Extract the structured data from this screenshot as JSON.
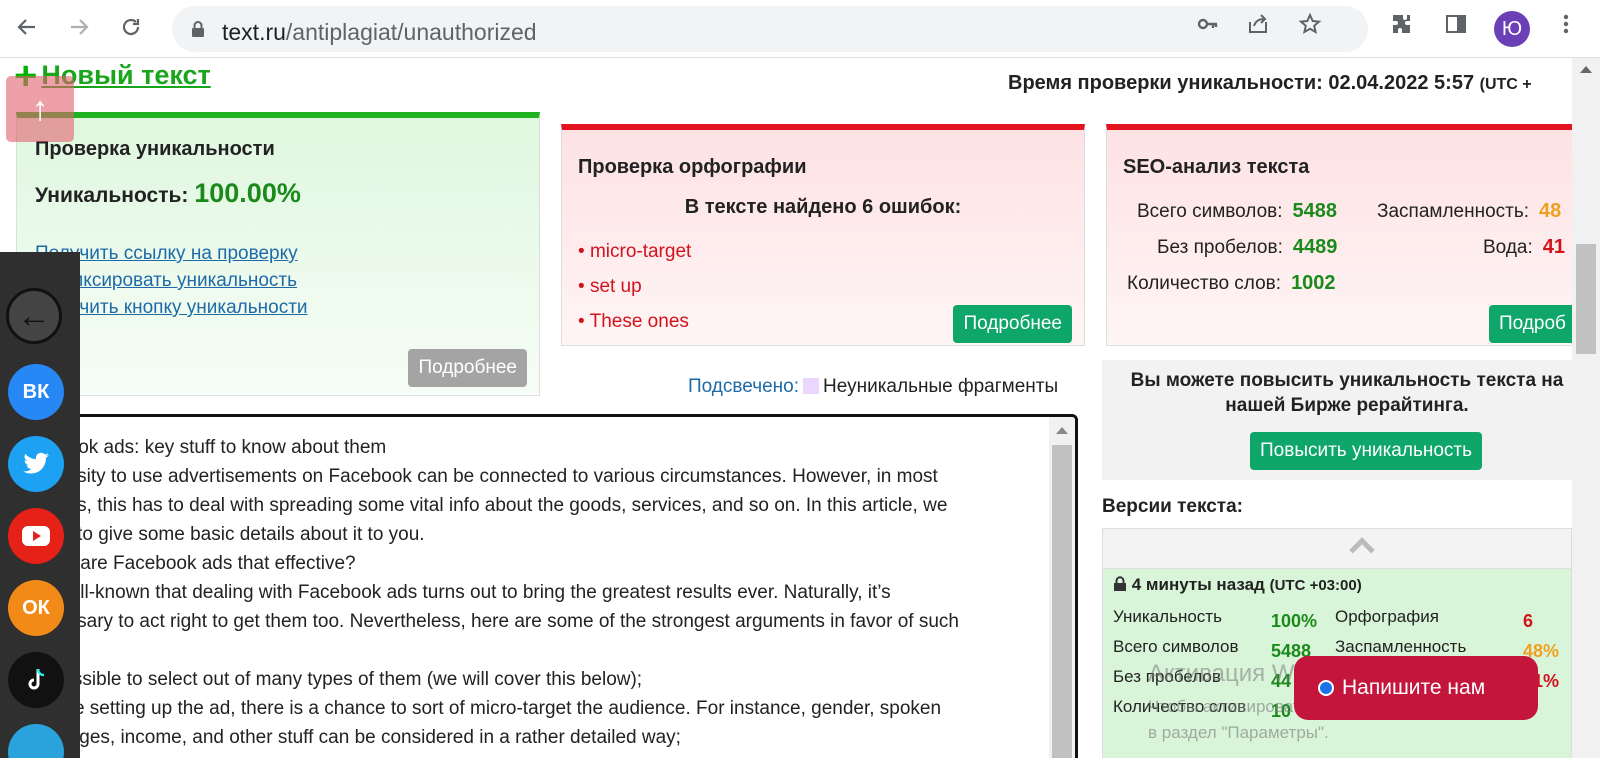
{
  "browser": {
    "url_host": "text.ru",
    "url_path": "/antiplagiat/unauthorized",
    "profile_initial": "Ю",
    "icons": [
      "back-icon",
      "forward-icon",
      "reload-icon",
      "lock-icon",
      "key-icon",
      "share-icon",
      "star-icon",
      "extensions-icon",
      "sidepanel-icon",
      "menu-icon"
    ]
  },
  "header": {
    "new_text_label": "Новый текст",
    "check_time": "Время проверки уникальности: 02.04.2022 5:57",
    "check_time_tz": "(UTC +"
  },
  "uniqueness_card": {
    "title": "Проверка уникальности",
    "label": "Уникальность:",
    "value": "100.00%",
    "links": [
      "Получить ссылку на проверку",
      "Зафиксировать уникальность",
      "Получить кнопку уникальности"
    ],
    "more_button": "Подробнее"
  },
  "spelling_card": {
    "title": "Проверка орфографии",
    "subtitle": "В тексте найдено 6 ошибок:",
    "errors": [
      "micro-target",
      "set up",
      "These ones"
    ],
    "more_button": "Подробнее"
  },
  "seo_card": {
    "title": "SEO-анализ текста",
    "total_chars_label": "Всего символов:",
    "total_chars_value": "5488",
    "no_spaces_label": "Без пробелов:",
    "no_spaces_value": "4489",
    "words_label": "Количество слов:",
    "words_value": "1002",
    "spam_label": "Заспамленность:",
    "spam_value": "48",
    "water_label": "Вода:",
    "water_value": "41",
    "more_button": "Подроб"
  },
  "highlight": {
    "label": "Подсвечено:",
    "legend": "Неуникальные фрагменты",
    "swatch_color": "#ead6ff"
  },
  "text_content": {
    "lines": [
      "cebook ads: key stuff to know about them",
      "ecessity to use advertisements on Facebook can be connected to various circumstances. However, in most",
      "cases, this has to deal with spreading some vital info about the goods, services, and so on. In this article, we",
      "ll try to give some basic details about it to you.",
      "Why are Facebook ads that effective?",
      "is well-known that dealing with Facebook ads turns out to bring the greatest results ever. Naturally, it’s",
      "ecessary to act right to get them too. Nevertheless, here are some of the strongest arguments in favor of such",
      "ads:",
      "s possible to select out of many types of them (we will cover this below);",
      "While setting up the ad, there is a chance to sort of micro-target the audience. For instance, gender, spoken",
      "nguages, income, and other stuff can be considered in a rather detailed way;"
    ]
  },
  "promo": {
    "text": "Вы можете повысить уникальность текста на нашей Бирже рерайтинга.",
    "button": "Повысить уникальность"
  },
  "versions": {
    "title": "Версии текста:",
    "entry_time": "4 минуты назад",
    "entry_tz": "(UTC +03:00)",
    "uniq_label": "Уникальность",
    "uniq_value": "100%",
    "orth_label": "Орфография",
    "orth_value": "6",
    "chars_label": "Всего символов",
    "chars_value": "5488",
    "spam_label": "Заспамленность",
    "spam_value": "48%",
    "nospace_label": "Без пробелов",
    "nospace_value": "44",
    "water_value": "1%",
    "words_label": "Количество слов",
    "words_value": "10"
  },
  "overlay": {
    "windows_activation": "Активация Windows",
    "windows_hint_line1": "Чтобы активировать Windows, перейдите",
    "windows_hint_line2": "в раздел \"Параметры\".",
    "chat_button": "Напишите нам"
  },
  "social": {
    "vk": "ВК",
    "ok": "ОК"
  }
}
